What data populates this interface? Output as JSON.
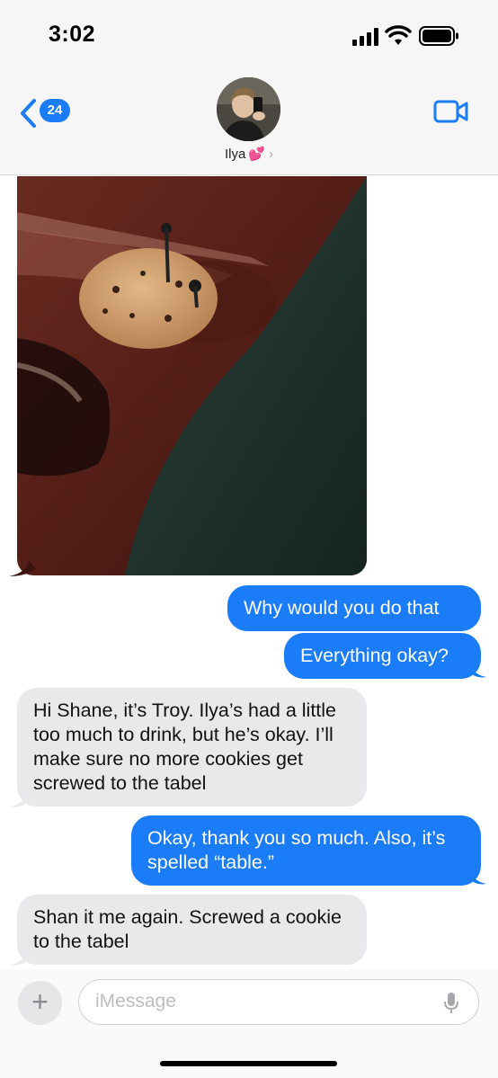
{
  "status_bar": {
    "time": "3:02"
  },
  "header": {
    "back_badge": "24",
    "contact_name": "Ilya",
    "contact_emoji": "💕"
  },
  "messages": [
    {
      "type": "image",
      "direction": "in",
      "description_icon": "photo"
    },
    {
      "direction": "out",
      "text": "Why would you do that"
    },
    {
      "direction": "out",
      "text": "Everything okay?"
    },
    {
      "direction": "in",
      "text": "Hi Shane, it’s Troy. Ilya’s had a little too much to drink, but he’s okay. I’ll make sure no more cookies get screwed to the tabel"
    },
    {
      "direction": "out",
      "text": "Okay, thank you so much. Also, it’s spelled “table.”"
    },
    {
      "direction": "in",
      "text": "Shan it me again. Screwed a cookie to the tabel"
    }
  ],
  "composer": {
    "placeholder": "iMessage",
    "plus_label": "+"
  },
  "colors": {
    "outgoing": "#1a7cf7",
    "incoming": "#e9e9eb"
  }
}
